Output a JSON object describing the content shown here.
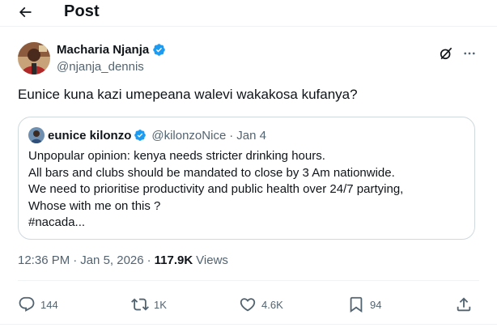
{
  "header": {
    "title": "Post"
  },
  "author": {
    "display_name": "Macharia Njanja",
    "handle": "@njanja_dennis"
  },
  "tweet": {
    "text": "Eunice kuna kazi umepeana walevi wakakosa kufanya?"
  },
  "quote": {
    "display_name": "eunice kilonzo",
    "handle": "@kilonzoNice",
    "separator": "·",
    "date": "Jan 4",
    "lines": [
      "Unpopular opinion: kenya needs stricter drinking hours.",
      "All bars and clubs should be mandated to close by 3 Am nationwide.",
      "We need to prioritise productivity and public health over 24/7 partying,",
      "Whose with me on this ?",
      "#nacada..."
    ]
  },
  "meta": {
    "time": "12:36 PM",
    "separator": "·",
    "date": "Jan 5, 2026",
    "views_count": "117.9K",
    "views_label": "Views"
  },
  "actions": {
    "replies": "144",
    "reposts": "1K",
    "likes": "4.6K",
    "bookmarks": "94"
  },
  "colors": {
    "text_primary": "#0f1419",
    "text_secondary": "#536471",
    "border": "#cfd9de",
    "verified": "#1d9bf0"
  },
  "icons": {
    "back": "arrow-left-icon",
    "verified": "verified-badge-icon",
    "grok": "grok-icon",
    "more": "more-horizontal-icon",
    "reply": "reply-icon",
    "repost": "repost-icon",
    "like": "heart-icon",
    "bookmark": "bookmark-icon",
    "share": "share-icon"
  }
}
